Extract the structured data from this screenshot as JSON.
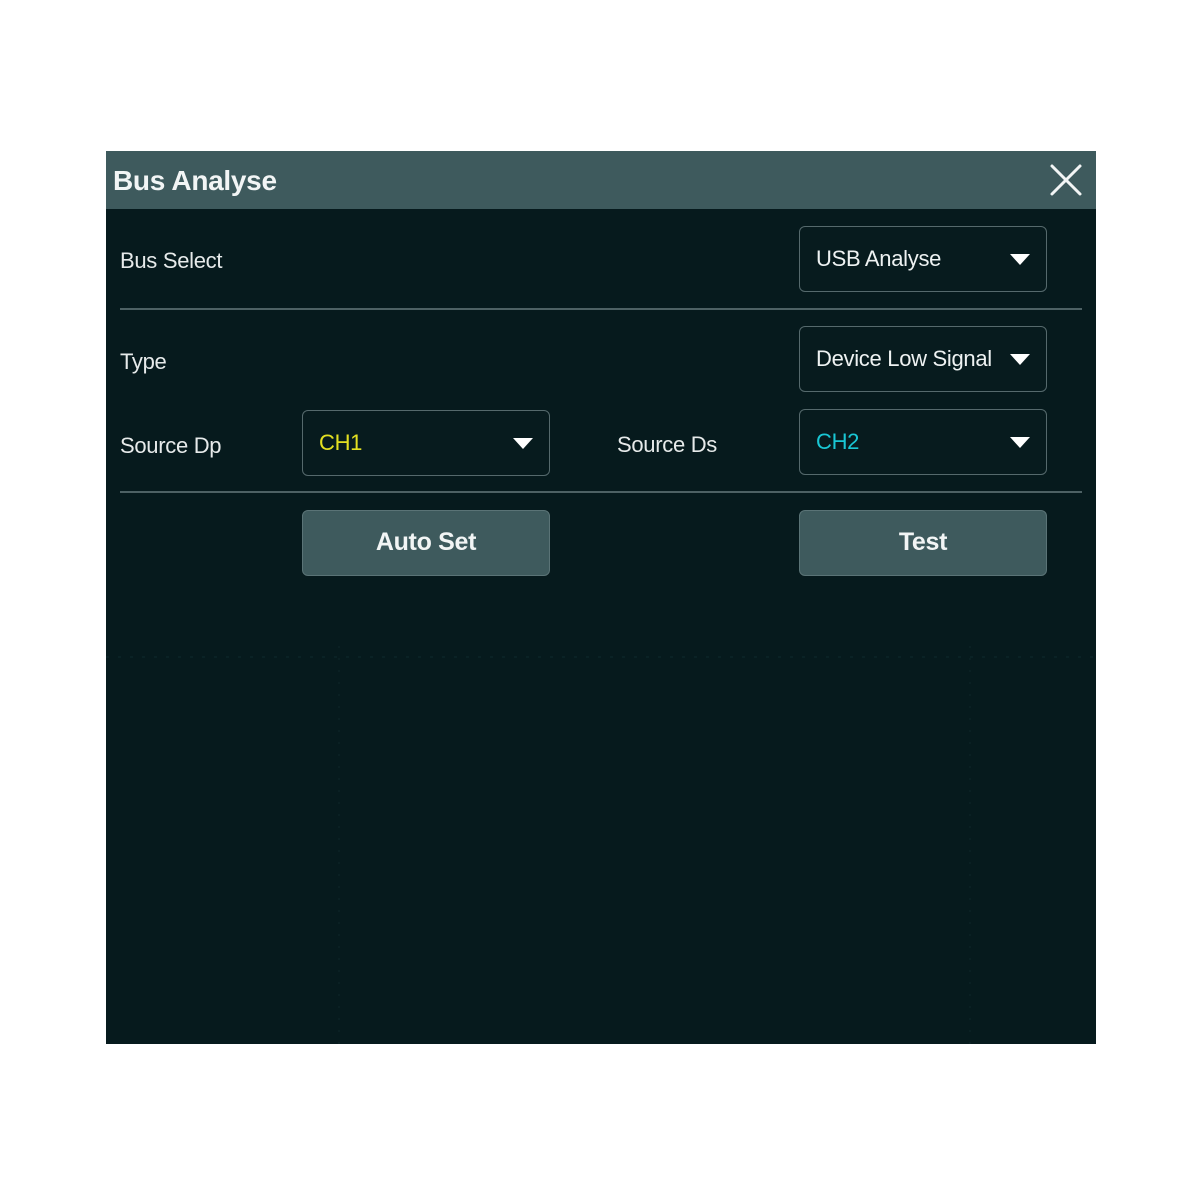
{
  "dialog": {
    "title": "Bus Analyse",
    "close_icon": "close-icon"
  },
  "bus_select": {
    "label": "Bus Select",
    "value": "USB Analyse"
  },
  "type": {
    "label": "Type",
    "value": "Device Low Signal"
  },
  "source_dp": {
    "label": "Source Dp",
    "value": "CH1",
    "color": "#e3e021"
  },
  "source_ds": {
    "label": "Source Ds",
    "value": "CH2",
    "color": "#19c7d4"
  },
  "buttons": {
    "auto_set": "Auto Set",
    "test": "Test"
  },
  "colors": {
    "background": "#061a1d",
    "titlebar": "#3e5a5d",
    "button": "#3e5a5d"
  }
}
